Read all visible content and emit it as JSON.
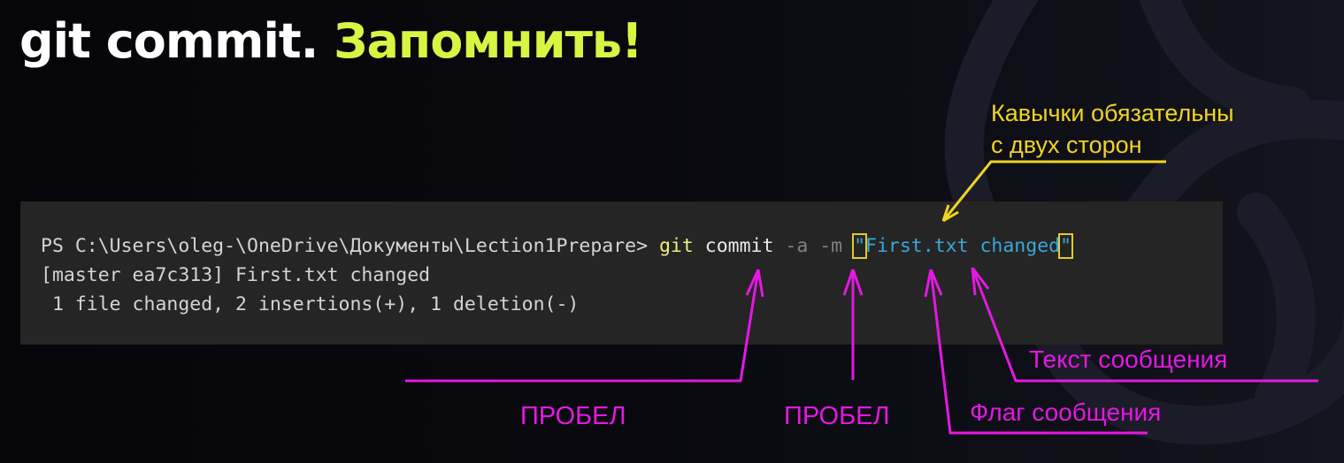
{
  "slide": {
    "title_main": "git commit.",
    "title_accent": "Запомнить!",
    "colors": {
      "accent": "#d7f542",
      "callout_yellow": "#f0d420",
      "callout_magenta": "#e418e2",
      "terminal_bg": "#252525",
      "string_blue": "#3aa7d8"
    }
  },
  "terminal": {
    "line1": {
      "prompt": "PS C:\\Users\\oleg-\\OneDrive\\Документы\\Lection1Prepare> ",
      "command": "git",
      "subcommand": " commit ",
      "flag_a": "-a",
      "flag_m": "-m",
      "quote_open": "\"",
      "message": "First.txt changed",
      "quote_close": "\""
    },
    "line2": "[master ea7c313] First.txt changed",
    "line3": " 1 file changed, 2 insertions(+), 1 deletion(-)"
  },
  "annotations": {
    "quotes_note_line1": "Кавычки обязательны",
    "quotes_note_line2": "с двух сторон",
    "space_label_1": "ПРОБЕЛ",
    "space_label_2": "ПРОБЕЛ",
    "flag_label": "Флаг сообщения",
    "text_label": "Текст сообщения"
  }
}
